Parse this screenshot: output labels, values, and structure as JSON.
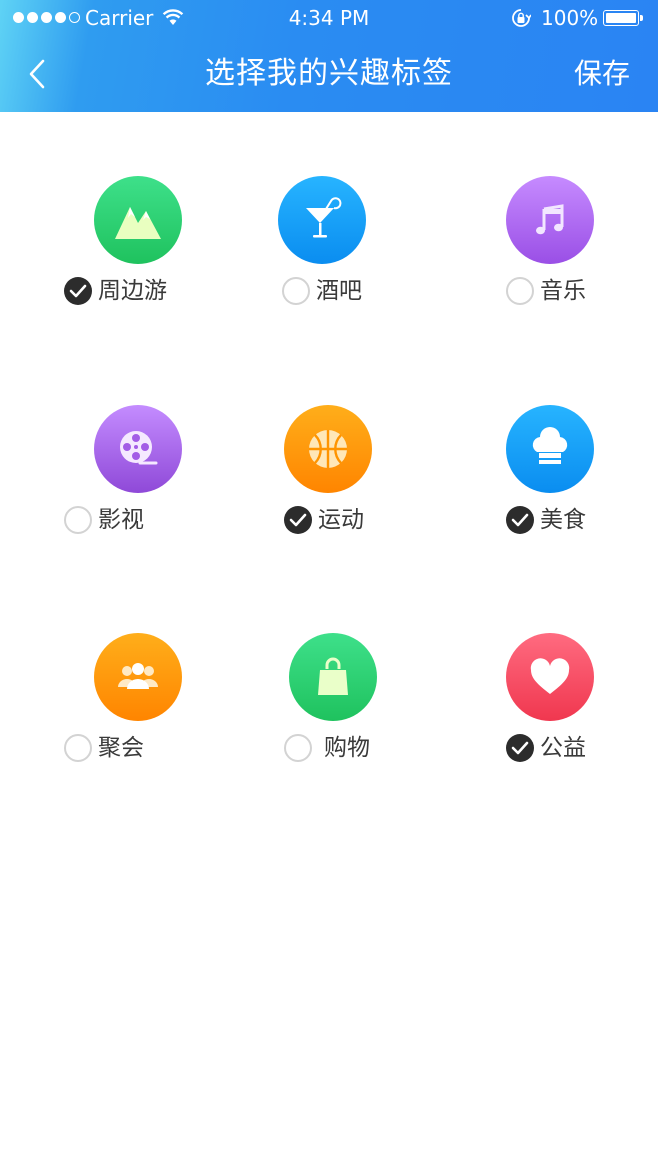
{
  "status_bar": {
    "carrier": "Carrier",
    "time": "4:34 PM",
    "battery": "100%"
  },
  "nav": {
    "title": "选择我的兴趣标签",
    "save_label": "保存",
    "back_icon": "chevron-left-icon"
  },
  "tags": [
    {
      "label": "周边游",
      "checked": true,
      "icon": "mountain-icon",
      "color_top": "#3ee08a",
      "color_bottom": "#1fc25e"
    },
    {
      "label": "酒吧",
      "checked": false,
      "icon": "cocktail-icon",
      "color_top": "#27b4ff",
      "color_bottom": "#0a8df0"
    },
    {
      "label": "音乐",
      "checked": false,
      "icon": "music-note-icon",
      "color_top": "#c68bff",
      "color_bottom": "#9a4fe6"
    },
    {
      "label": "影视",
      "checked": false,
      "icon": "film-reel-icon",
      "color_top": "#c48cff",
      "color_bottom": "#8f49d8"
    },
    {
      "label": "运动",
      "checked": true,
      "icon": "basketball-icon",
      "color_top": "#ffae1a",
      "color_bottom": "#ff8500"
    },
    {
      "label": "美食",
      "checked": true,
      "icon": "chef-hat-icon",
      "color_top": "#27b4ff",
      "color_bottom": "#0a8df0"
    },
    {
      "label": "聚会",
      "checked": false,
      "icon": "people-icon",
      "color_top": "#ffae1a",
      "color_bottom": "#ff8500"
    },
    {
      "label": "购物",
      "checked": false,
      "icon": "shopping-bag-icon",
      "color_top": "#3ee08a",
      "color_bottom": "#1fc25e"
    },
    {
      "label": "公益",
      "checked": true,
      "icon": "heart-icon",
      "color_top": "#ff6b80",
      "color_bottom": "#f0374f"
    }
  ]
}
